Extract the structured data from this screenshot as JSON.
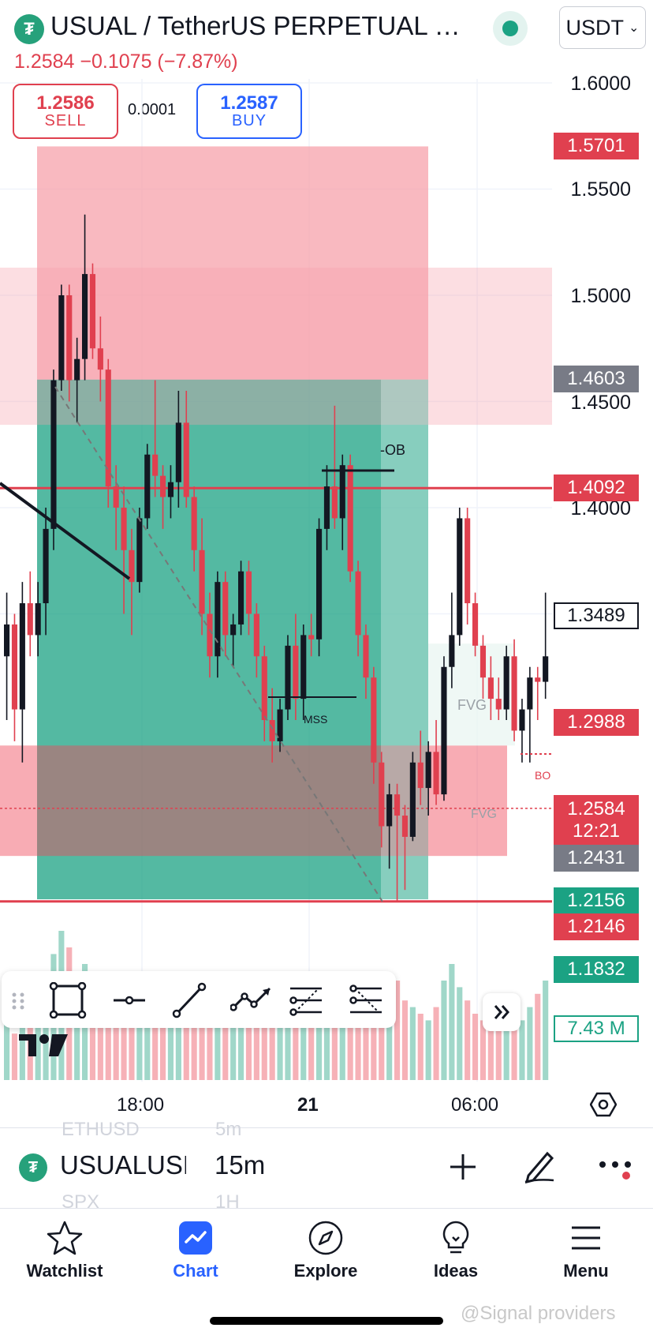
{
  "header": {
    "title": "USUAL / TetherUS PERPETUAL CO...",
    "currency": "USDT",
    "price_change": "1.2584  −0.1075 (−7.87%)",
    "sell_price": "1.2586",
    "sell_label": "SELL",
    "spread": "0.0001",
    "buy_price": "1.2587",
    "buy_label": "BUY"
  },
  "price_axis": [
    "1.6000",
    "1.5500",
    "1.5000",
    "1.4500",
    "1.4000",
    "1.3500"
  ],
  "price_tags": {
    "t1": "1.5701",
    "t2": "1.4603",
    "t3": "1.4092",
    "t4": "1.3489",
    "t5": "1.2988",
    "t6": "1.2584",
    "t6b": "12:21",
    "t7": "1.2431",
    "t8": "1.2156",
    "t9": "1.2146",
    "t10": "1.1832",
    "t11": "7.43 M"
  },
  "chart_labels": {
    "ob": "-OB",
    "mss": "MSS",
    "fvg1": "FVG",
    "fvg2": "FVG",
    "bo": "BO"
  },
  "time_axis": [
    "18:00",
    "21",
    "06:00"
  ],
  "symbol_bar": {
    "symbol": "USUALUSDT",
    "interval": "15m",
    "ghost_symbol_top": "ETHUSD",
    "ghost_interval_top": "5m",
    "ghost_symbol_bottom": "SPX",
    "ghost_interval_bottom": "1H"
  },
  "nav": {
    "watchlist": "Watchlist",
    "chart": "Chart",
    "explore": "Explore",
    "ideas": "Ideas",
    "menu": "Menu"
  },
  "watermark": "@Signal providers",
  "colors": {
    "red": "#e0404f",
    "green": "#1ba283",
    "blue": "#2962ff",
    "grey": "#787b86"
  },
  "chart_data": {
    "type": "candlestick",
    "symbol": "USUALUSDT",
    "interval": "15m",
    "ylim": [
      1.17,
      1.61
    ],
    "y_ticks": [
      1.6,
      1.55,
      1.5,
      1.45,
      1.4,
      1.35
    ],
    "x_ticks": [
      "18:00",
      "21",
      "06:00"
    ],
    "last_price": 1.2584,
    "candles": [
      {
        "o": 1.33,
        "h": 1.36,
        "l": 1.3,
        "c": 1.345
      },
      {
        "o": 1.345,
        "h": 1.35,
        "l": 1.29,
        "c": 1.305
      },
      {
        "o": 1.305,
        "h": 1.365,
        "l": 1.28,
        "c": 1.355
      },
      {
        "o": 1.355,
        "h": 1.37,
        "l": 1.33,
        "c": 1.34
      },
      {
        "o": 1.34,
        "h": 1.365,
        "l": 1.33,
        "c": 1.355
      },
      {
        "o": 1.355,
        "h": 1.4,
        "l": 1.34,
        "c": 1.39
      },
      {
        "o": 1.39,
        "h": 1.465,
        "l": 1.38,
        "c": 1.46
      },
      {
        "o": 1.46,
        "h": 1.505,
        "l": 1.455,
        "c": 1.5
      },
      {
        "o": 1.5,
        "h": 1.505,
        "l": 1.45,
        "c": 1.46
      },
      {
        "o": 1.46,
        "h": 1.48,
        "l": 1.44,
        "c": 1.47
      },
      {
        "o": 1.47,
        "h": 1.538,
        "l": 1.46,
        "c": 1.51
      },
      {
        "o": 1.51,
        "h": 1.515,
        "l": 1.47,
        "c": 1.475
      },
      {
        "o": 1.475,
        "h": 1.49,
        "l": 1.45,
        "c": 1.465
      },
      {
        "o": 1.465,
        "h": 1.47,
        "l": 1.4,
        "c": 1.41
      },
      {
        "o": 1.41,
        "h": 1.42,
        "l": 1.38,
        "c": 1.4
      },
      {
        "o": 1.4,
        "h": 1.41,
        "l": 1.35,
        "c": 1.38
      },
      {
        "o": 1.38,
        "h": 1.39,
        "l": 1.34,
        "c": 1.365
      },
      {
        "o": 1.365,
        "h": 1.4,
        "l": 1.36,
        "c": 1.395
      },
      {
        "o": 1.395,
        "h": 1.43,
        "l": 1.39,
        "c": 1.425
      },
      {
        "o": 1.425,
        "h": 1.46,
        "l": 1.405,
        "c": 1.415
      },
      {
        "o": 1.415,
        "h": 1.42,
        "l": 1.39,
        "c": 1.405
      },
      {
        "o": 1.405,
        "h": 1.42,
        "l": 1.395,
        "c": 1.412
      },
      {
        "o": 1.412,
        "h": 1.455,
        "l": 1.4,
        "c": 1.44
      },
      {
        "o": 1.44,
        "h": 1.455,
        "l": 1.4,
        "c": 1.405
      },
      {
        "o": 1.405,
        "h": 1.41,
        "l": 1.37,
        "c": 1.38
      },
      {
        "o": 1.38,
        "h": 1.395,
        "l": 1.34,
        "c": 1.35
      },
      {
        "o": 1.35,
        "h": 1.36,
        "l": 1.32,
        "c": 1.33
      },
      {
        "o": 1.33,
        "h": 1.37,
        "l": 1.32,
        "c": 1.365
      },
      {
        "o": 1.365,
        "h": 1.37,
        "l": 1.33,
        "c": 1.34
      },
      {
        "o": 1.34,
        "h": 1.35,
        "l": 1.325,
        "c": 1.345
      },
      {
        "o": 1.345,
        "h": 1.375,
        "l": 1.34,
        "c": 1.37
      },
      {
        "o": 1.37,
        "h": 1.375,
        "l": 1.34,
        "c": 1.35
      },
      {
        "o": 1.35,
        "h": 1.355,
        "l": 1.32,
        "c": 1.33
      },
      {
        "o": 1.33,
        "h": 1.335,
        "l": 1.29,
        "c": 1.3
      },
      {
        "o": 1.3,
        "h": 1.315,
        "l": 1.28,
        "c": 1.29
      },
      {
        "o": 1.29,
        "h": 1.31,
        "l": 1.285,
        "c": 1.305
      },
      {
        "o": 1.305,
        "h": 1.34,
        "l": 1.3,
        "c": 1.335
      },
      {
        "o": 1.335,
        "h": 1.35,
        "l": 1.3,
        "c": 1.31
      },
      {
        "o": 1.31,
        "h": 1.345,
        "l": 1.3,
        "c": 1.34
      },
      {
        "o": 1.34,
        "h": 1.35,
        "l": 1.33,
        "c": 1.338
      },
      {
        "o": 1.338,
        "h": 1.395,
        "l": 1.33,
        "c": 1.39
      },
      {
        "o": 1.39,
        "h": 1.42,
        "l": 1.38,
        "c": 1.41
      },
      {
        "o": 1.41,
        "h": 1.448,
        "l": 1.39,
        "c": 1.395
      },
      {
        "o": 1.395,
        "h": 1.425,
        "l": 1.38,
        "c": 1.42
      },
      {
        "o": 1.42,
        "h": 1.425,
        "l": 1.365,
        "c": 1.37
      },
      {
        "o": 1.37,
        "h": 1.375,
        "l": 1.33,
        "c": 1.34
      },
      {
        "o": 1.34,
        "h": 1.345,
        "l": 1.31,
        "c": 1.32
      },
      {
        "o": 1.32,
        "h": 1.325,
        "l": 1.27,
        "c": 1.28
      },
      {
        "o": 1.28,
        "h": 1.285,
        "l": 1.24,
        "c": 1.25
      },
      {
        "o": 1.25,
        "h": 1.27,
        "l": 1.23,
        "c": 1.265
      },
      {
        "o": 1.265,
        "h": 1.27,
        "l": 1.215,
        "c": 1.255
      },
      {
        "o": 1.255,
        "h": 1.26,
        "l": 1.22,
        "c": 1.245
      },
      {
        "o": 1.245,
        "h": 1.285,
        "l": 1.243,
        "c": 1.28
      },
      {
        "o": 1.28,
        "h": 1.295,
        "l": 1.26,
        "c": 1.268
      },
      {
        "o": 1.268,
        "h": 1.29,
        "l": 1.255,
        "c": 1.285
      },
      {
        "o": 1.285,
        "h": 1.3,
        "l": 1.26,
        "c": 1.265
      },
      {
        "o": 1.265,
        "h": 1.33,
        "l": 1.262,
        "c": 1.325
      },
      {
        "o": 1.325,
        "h": 1.36,
        "l": 1.315,
        "c": 1.34
      },
      {
        "o": 1.34,
        "h": 1.4,
        "l": 1.335,
        "c": 1.395
      },
      {
        "o": 1.395,
        "h": 1.4,
        "l": 1.345,
        "c": 1.355
      },
      {
        "o": 1.355,
        "h": 1.36,
        "l": 1.33,
        "c": 1.335
      },
      {
        "o": 1.335,
        "h": 1.34,
        "l": 1.31,
        "c": 1.32
      },
      {
        "o": 1.32,
        "h": 1.33,
        "l": 1.3,
        "c": 1.31
      },
      {
        "o": 1.31,
        "h": 1.32,
        "l": 1.3,
        "c": 1.305
      },
      {
        "o": 1.305,
        "h": 1.335,
        "l": 1.3,
        "c": 1.33
      },
      {
        "o": 1.33,
        "h": 1.338,
        "l": 1.29,
        "c": 1.295
      },
      {
        "o": 1.295,
        "h": 1.31,
        "l": 1.28,
        "c": 1.305
      },
      {
        "o": 1.305,
        "h": 1.325,
        "l": 1.28,
        "c": 1.32
      },
      {
        "o": 1.32,
        "h": 1.325,
        "l": 1.3,
        "c": 1.318
      },
      {
        "o": 1.318,
        "h": 1.36,
        "l": 1.31,
        "c": 1.33
      }
    ],
    "volume": [
      18,
      14,
      22,
      20,
      25,
      30,
      38,
      45,
      40,
      30,
      35,
      28,
      25,
      22,
      20,
      18,
      20,
      24,
      26,
      22,
      20,
      18,
      20,
      22,
      18,
      16,
      18,
      20,
      17,
      16,
      18,
      17,
      20,
      22,
      18,
      17,
      19,
      16,
      18,
      20,
      22,
      24,
      20,
      18,
      16,
      18,
      20,
      22,
      26,
      28,
      30,
      24,
      22,
      20,
      18,
      22,
      30,
      35,
      28,
      24,
      20,
      18,
      20,
      22,
      24,
      20,
      18,
      22,
      26,
      30
    ],
    "zones": [
      {
        "kind": "short-stop",
        "from": 1.5701,
        "to": 1.4603
      },
      {
        "kind": "short-target",
        "from": 1.4603,
        "to": 1.2156
      },
      {
        "kind": "supply",
        "from": 1.513,
        "to": 1.439
      },
      {
        "kind": "demand",
        "from": 1.288,
        "to": 1.236
      }
    ],
    "levels": [
      1.4092,
      1.2146
    ]
  }
}
